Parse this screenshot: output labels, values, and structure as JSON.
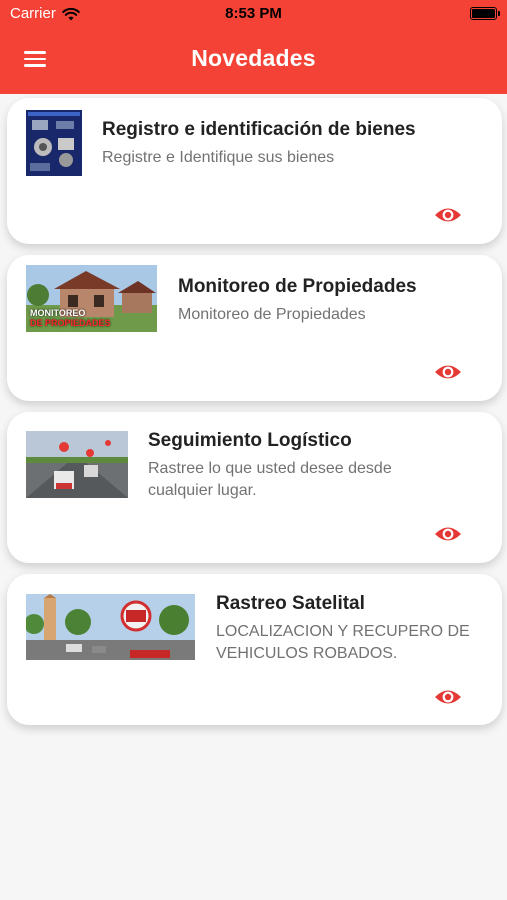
{
  "status_bar": {
    "carrier": "Carrier",
    "time": "8:53 PM"
  },
  "header": {
    "title": "Novedades",
    "menu_icon": "hamburger-menu-icon"
  },
  "colors": {
    "accent": "#f44336",
    "title_text": "#222222",
    "desc_text": "#727272"
  },
  "cards": [
    {
      "title": "Registro e identificación de bienes",
      "description": "Registre e Identifique sus bienes",
      "action_icon": "eye-icon"
    },
    {
      "title": "Monitoreo de Propiedades",
      "description": "Monitoreo de Propiedades",
      "thumb_caption_line1": "MONITOREO",
      "thumb_caption_line2": "DE PROPIEDADES",
      "action_icon": "eye-icon"
    },
    {
      "title": "Seguimiento Logístico",
      "description": "Rastree lo que usted desee desde cualquier lugar.",
      "action_icon": "eye-icon"
    },
    {
      "title": "Rastreo Satelital",
      "description": "LOCALIZACION Y RECUPERO DE VEHICULOS ROBADOS.",
      "action_icon": "eye-icon"
    }
  ]
}
